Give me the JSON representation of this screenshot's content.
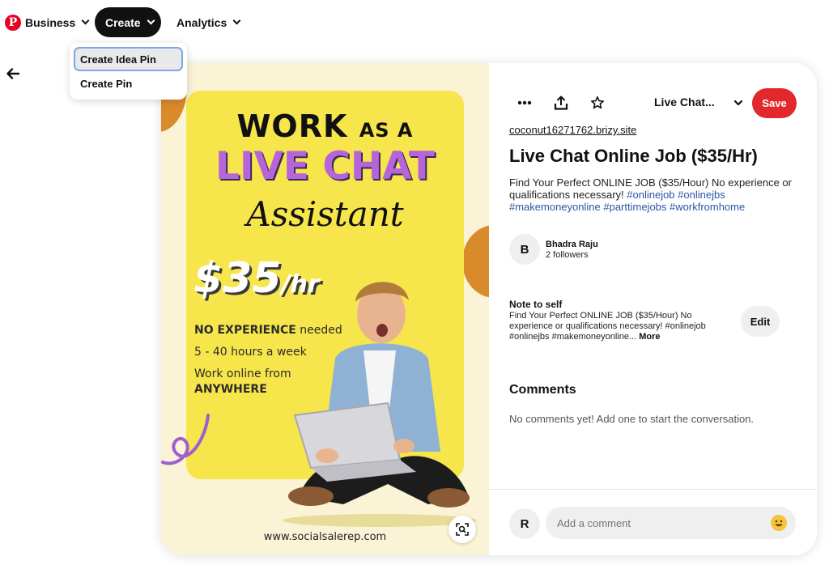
{
  "nav": {
    "business_label": "Business",
    "create_label": "Create",
    "analytics_label": "Analytics"
  },
  "create_menu": {
    "items": [
      "Create Idea Pin",
      "Create Pin"
    ]
  },
  "pin_image": {
    "headline_work": "WORK",
    "headline_as_a": "AS A",
    "headline_live_chat": "LIVE CHAT",
    "headline_assistant": "Assistant",
    "price_main": "$35",
    "price_unit": "/hr",
    "line_1_bold": "NO EXPERIENCE",
    "line_1_rest": "needed",
    "line_2": "5 - 40 hours a week",
    "line_3": "Work online from",
    "line_4": "ANYWHERE",
    "website": "www.socialsalerep.com"
  },
  "details": {
    "board_name": "Live Chat...",
    "save_label": "Save",
    "source_url": "coconut16271762.brizy.site",
    "title": "Live Chat Online Job ($35/Hr)",
    "description": "Find Your Perfect ONLINE JOB ($35/Hour) No experience or qualifications necessary!",
    "hashtags": [
      "#onlinejob",
      "#onlinejbs",
      "#makemoneyonline",
      "#parttimejobs",
      "#workfromhome"
    ],
    "author": {
      "initial": "B",
      "name": "Bhadra Raju",
      "followers": "2 followers"
    },
    "note": {
      "title": "Note to self",
      "text": "Find Your Perfect ONLINE JOB ($35/Hour) No experience or qualifications necessary! #onlinejob #onlinejbs #makemoneyonline...",
      "more_label": "More",
      "edit_label": "Edit"
    },
    "comments": {
      "title": "Comments",
      "empty_text": "No comments yet! Add one to start the conversation.",
      "user_initial": "R",
      "input_placeholder": "Add a comment"
    }
  },
  "colors": {
    "brand_red": "#e60023",
    "save_red": "#e2282d",
    "poster_yellow": "#f6e54b",
    "accent_purple": "#b565d9",
    "hashtag_blue": "#2a56a8"
  },
  "icons": [
    "pinterest-logo-icon",
    "chevron-down-icon",
    "back-arrow-icon",
    "more-dots-icon",
    "share-icon",
    "star-icon",
    "visual-search-icon",
    "emoji-icon"
  ]
}
